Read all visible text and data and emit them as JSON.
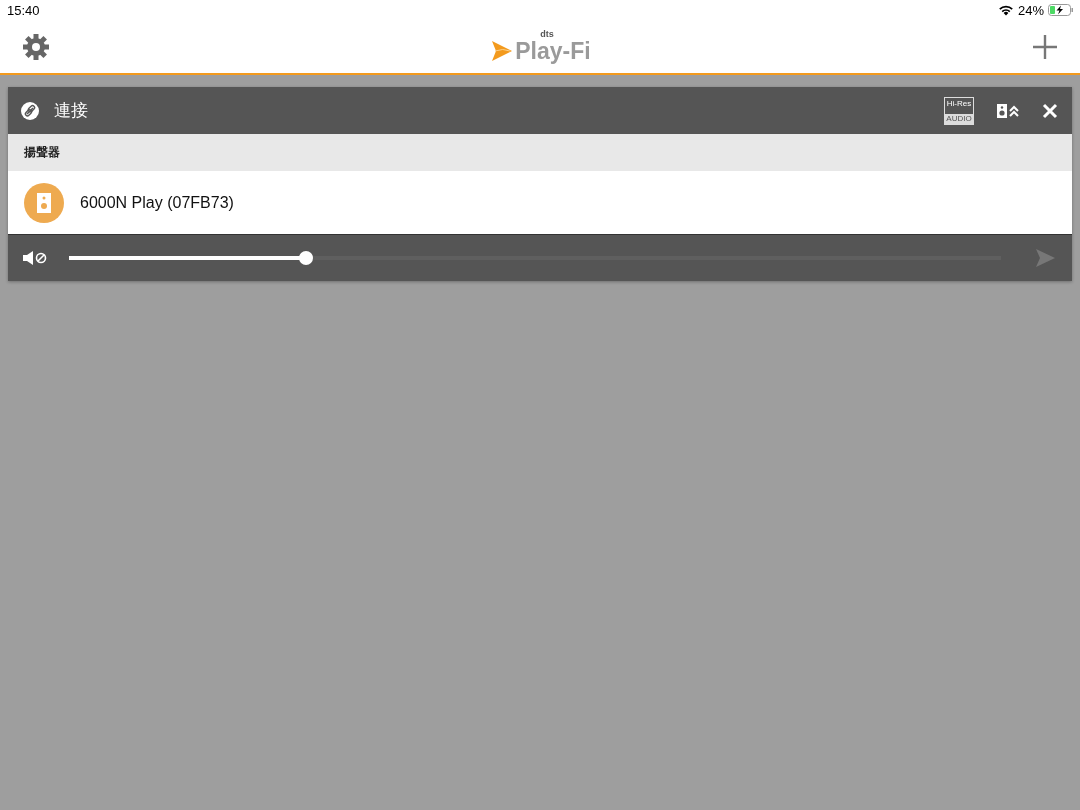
{
  "status_bar": {
    "time": "15:40",
    "battery": "24%"
  },
  "header": {
    "logo": {
      "brand": "dts",
      "name": "Play-Fi"
    }
  },
  "panel": {
    "title": "連接",
    "hires": {
      "top": "Hi-Res",
      "bottom": "AUDIO"
    },
    "section": "揚聲器",
    "devices": [
      {
        "name": "6000N Play (07FB73)"
      }
    ],
    "volume": {
      "level": 0.254,
      "send_enabled": false
    }
  }
}
